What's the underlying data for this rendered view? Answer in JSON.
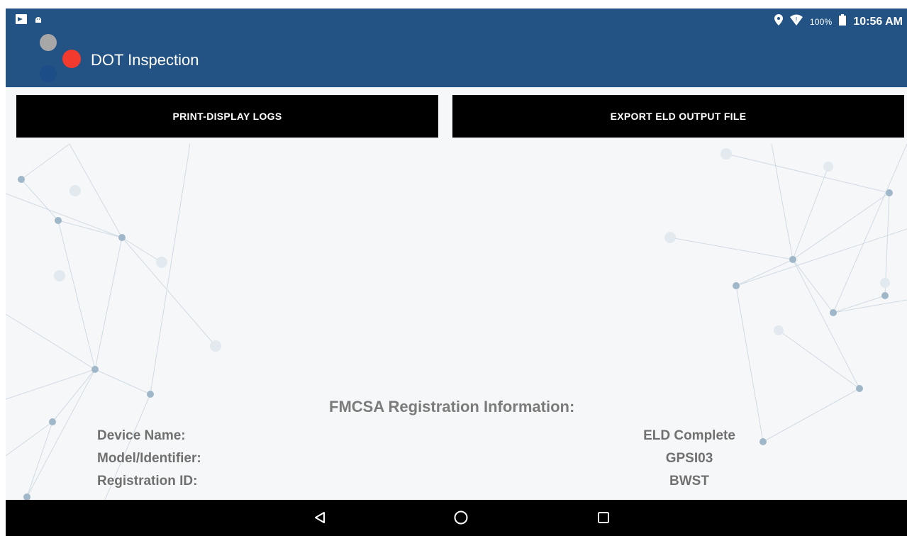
{
  "status_bar": {
    "left_icons": [
      "notification-icon",
      "android-icon"
    ],
    "right_icons": [
      "location-icon",
      "wifi-icon",
      "battery-icon"
    ],
    "battery": "100%",
    "time": "10:56 AM"
  },
  "app_bar": {
    "title": "DOT Inspection"
  },
  "actions": {
    "print_label": "PRINT-DISPLAY LOGS",
    "export_label": "EXPORT ELD OUTPUT FILE"
  },
  "registration": {
    "title": "FMCSA Registration Information:",
    "rows": [
      {
        "label": "Device Name:",
        "value": "ELD Complete"
      },
      {
        "label": "Model/Identifier:",
        "value": "GPSI03"
      },
      {
        "label": "Registration ID:",
        "value": "BWST"
      }
    ]
  },
  "nav_bar": {
    "icons": [
      "back-icon",
      "home-icon",
      "recents-icon"
    ]
  },
  "colors": {
    "app_bar": "#225384",
    "button": "#000000",
    "logo_gray": "#a7a7a7",
    "logo_red": "#f23a2f",
    "logo_blue": "#1d4d86"
  }
}
